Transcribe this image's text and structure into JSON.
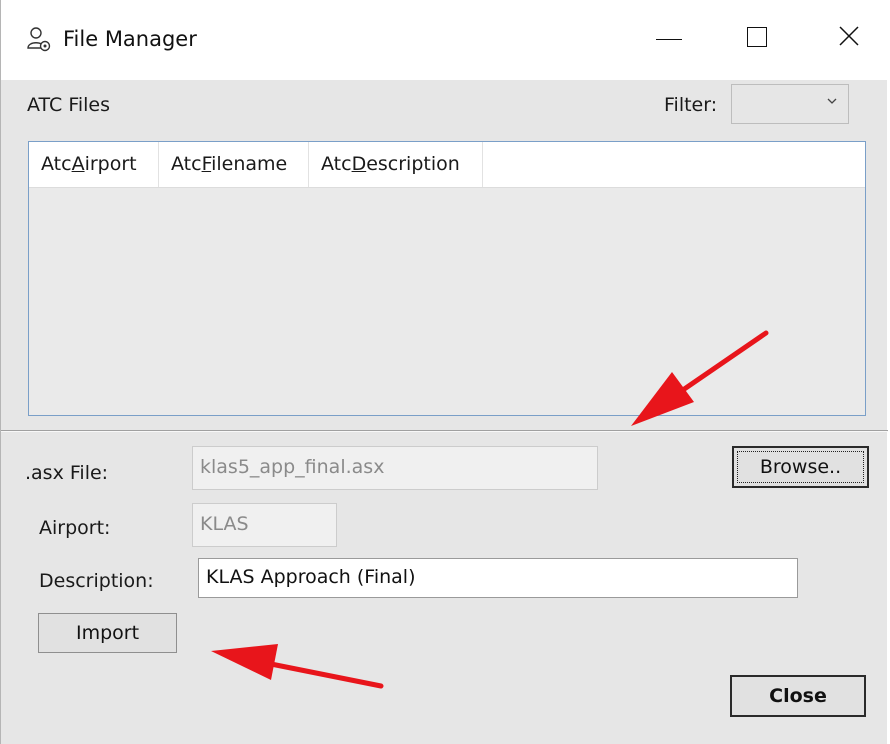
{
  "window": {
    "title": "File Manager",
    "icon": "users-gear-icon"
  },
  "header": {
    "section_label": "ATC Files",
    "filter_label": "Filter:",
    "filter_value": ""
  },
  "list": {
    "columns": [
      {
        "prefix": "Atc",
        "accel": "A",
        "rest": "irport"
      },
      {
        "prefix": "Atc",
        "accel": "F",
        "rest": "ilename"
      },
      {
        "prefix": "Atc",
        "accel": "D",
        "rest": "escription"
      }
    ],
    "rows": []
  },
  "form": {
    "asx_label": ".asx File:",
    "asx_value": "klas5_app_final.asx",
    "browse_label": "Browse..",
    "airport_label": "Airport:",
    "airport_value": "KLAS",
    "description_label": "Description:",
    "description_value": "KLAS Approach (Final)",
    "import_label": "Import",
    "close_label": "Close"
  },
  "annotations": {
    "arrow_color": "#e8151b"
  }
}
